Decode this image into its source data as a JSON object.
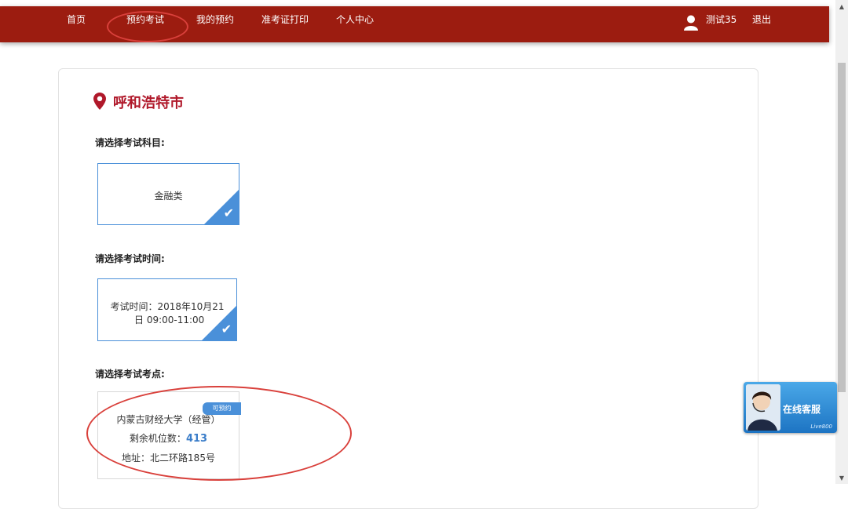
{
  "navbar": {
    "items": [
      {
        "label": "首页"
      },
      {
        "label": "预约考试"
      },
      {
        "label": "我的预约"
      },
      {
        "label": "准考证打印"
      },
      {
        "label": "个人中心"
      }
    ],
    "user_icon": "user-icon",
    "user_name": "测试35",
    "logout": "退出"
  },
  "city": {
    "name": "呼和浩特市",
    "icon": "location-pin-icon"
  },
  "subject_section": {
    "label": "请选择考试科目:",
    "selected": "金融类"
  },
  "time_section": {
    "label": "请选择考试时间:",
    "line1": "考试时间：2018年10月21",
    "line2": "日 09:00-11:00"
  },
  "site_section": {
    "label": "请选择考试考点:",
    "badge": "可预约",
    "name": "内蒙古财经大学（经管）",
    "seats_label": "剩余机位数：",
    "seats_value": "413",
    "address": "地址：北二环路185号"
  },
  "support": {
    "label": "在线客服",
    "brand": "Live800"
  },
  "colors": {
    "navbar": "#9c1c10",
    "accent_blue": "#4a90d9",
    "city_red": "#b0182a",
    "annotation_red": "#d9403b"
  }
}
